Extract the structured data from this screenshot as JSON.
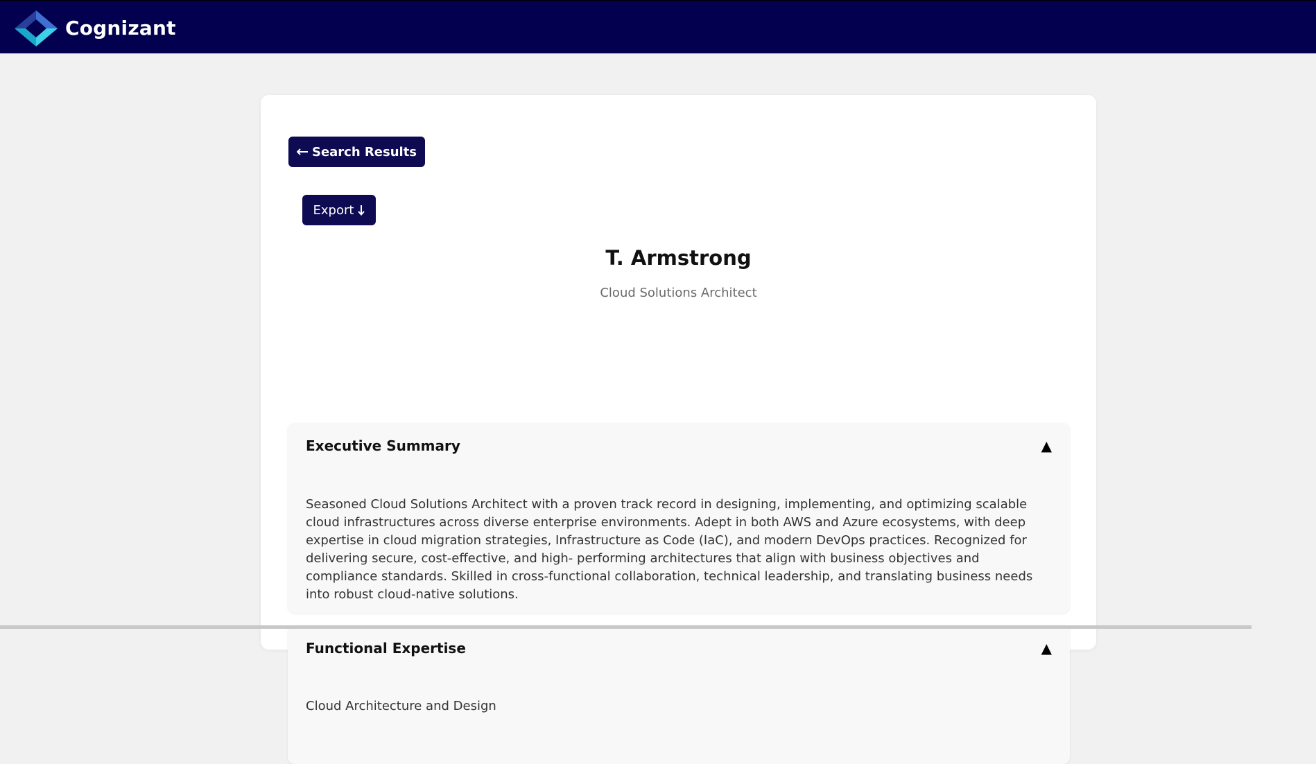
{
  "header": {
    "brand": "Cognizant",
    "background": "#02004f",
    "logo_colors": [
      "#1a3a8a",
      "#1f8fd8",
      "#3dd1e8"
    ]
  },
  "actions": {
    "back_label": "Search Results",
    "back_icon": "arrow-left-icon",
    "export_label": "Export",
    "export_icon": "download-arrow-icon",
    "button_color": "#0e0b52"
  },
  "profile": {
    "name": "T. Armstrong",
    "role": "Cloud Solutions Architect"
  },
  "sections": [
    {
      "title": "Executive Summary",
      "toggle": "▲",
      "body": "Seasoned Cloud Solutions Architect with a proven track record in designing, implementing, and optimizing scalable cloud infrastructures across diverse enterprise environments. Adept in both AWS and Azure ecosystems, with deep expertise in cloud migration strategies, Infrastructure as Code (IaC), and modern DevOps practices. Recognized for delivering secure, cost-effective, and high- performing architectures that align with business objectives and compliance standards. Skilled in cross-functional collaboration, technical leadership, and translating business needs into robust cloud-native solutions."
    },
    {
      "title": "Functional Expertise",
      "toggle": "▲",
      "body": "Cloud Architecture and Design"
    }
  ]
}
